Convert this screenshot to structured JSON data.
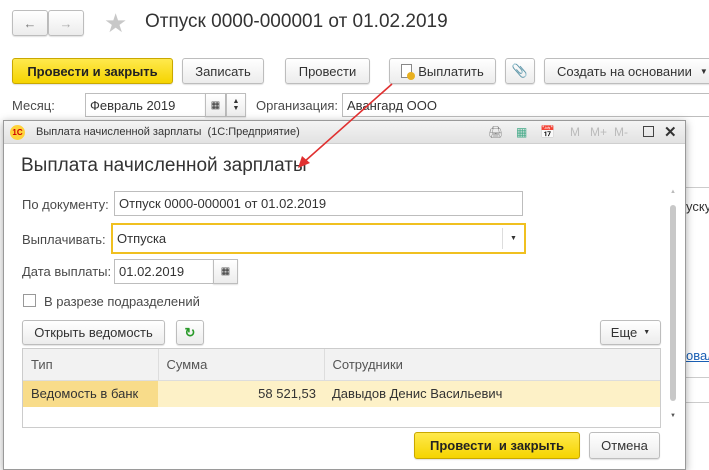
{
  "main": {
    "title": "Отпуск 0000-000001 от 01.02.2019",
    "toolbar": {
      "post_close": "Провести и закрыть",
      "save": "Записать",
      "post": "Провести",
      "pay": "Выплатить",
      "create_based": "Создать на основании"
    },
    "month_label": "Месяц:",
    "month_value": "Февраль 2019",
    "org_label": "Организация:",
    "org_value": "Авангард ООО",
    "bg_text_1": "уску",
    "bg_link": "овал"
  },
  "dialog": {
    "window_title": "Выплата начисленной зарплаты  (1С:Предприятие)",
    "title_buttons": [
      "M",
      "M+",
      "M-"
    ],
    "heading": "Выплата начисленной зарплаты",
    "doc_label": "По документу:",
    "doc_value": "Отпуск 0000-000001 от 01.02.2019",
    "pay_label": "Выплачивать:",
    "pay_value": "Отпуска",
    "date_label": "Дата выплаты:",
    "date_value": "01.02.2019",
    "checkbox_label": "В разрезе подразделений",
    "checkbox_checked": false,
    "open_statement": "Открыть ведомость",
    "more": "Еще",
    "table": {
      "headers": [
        "Тип",
        "Сумма",
        "Сотрудники"
      ],
      "rows": [
        {
          "type": "Ведомость в банк",
          "sum": "58 521,53",
          "employees": "Давыдов Денис Васильевич"
        }
      ]
    },
    "post_close": "Провести  и закрыть",
    "cancel": "Отмена"
  },
  "colors": {
    "accent_yellow": "#f5d400",
    "selected_row": "#fdf1c7",
    "arrow": "#e03030"
  }
}
